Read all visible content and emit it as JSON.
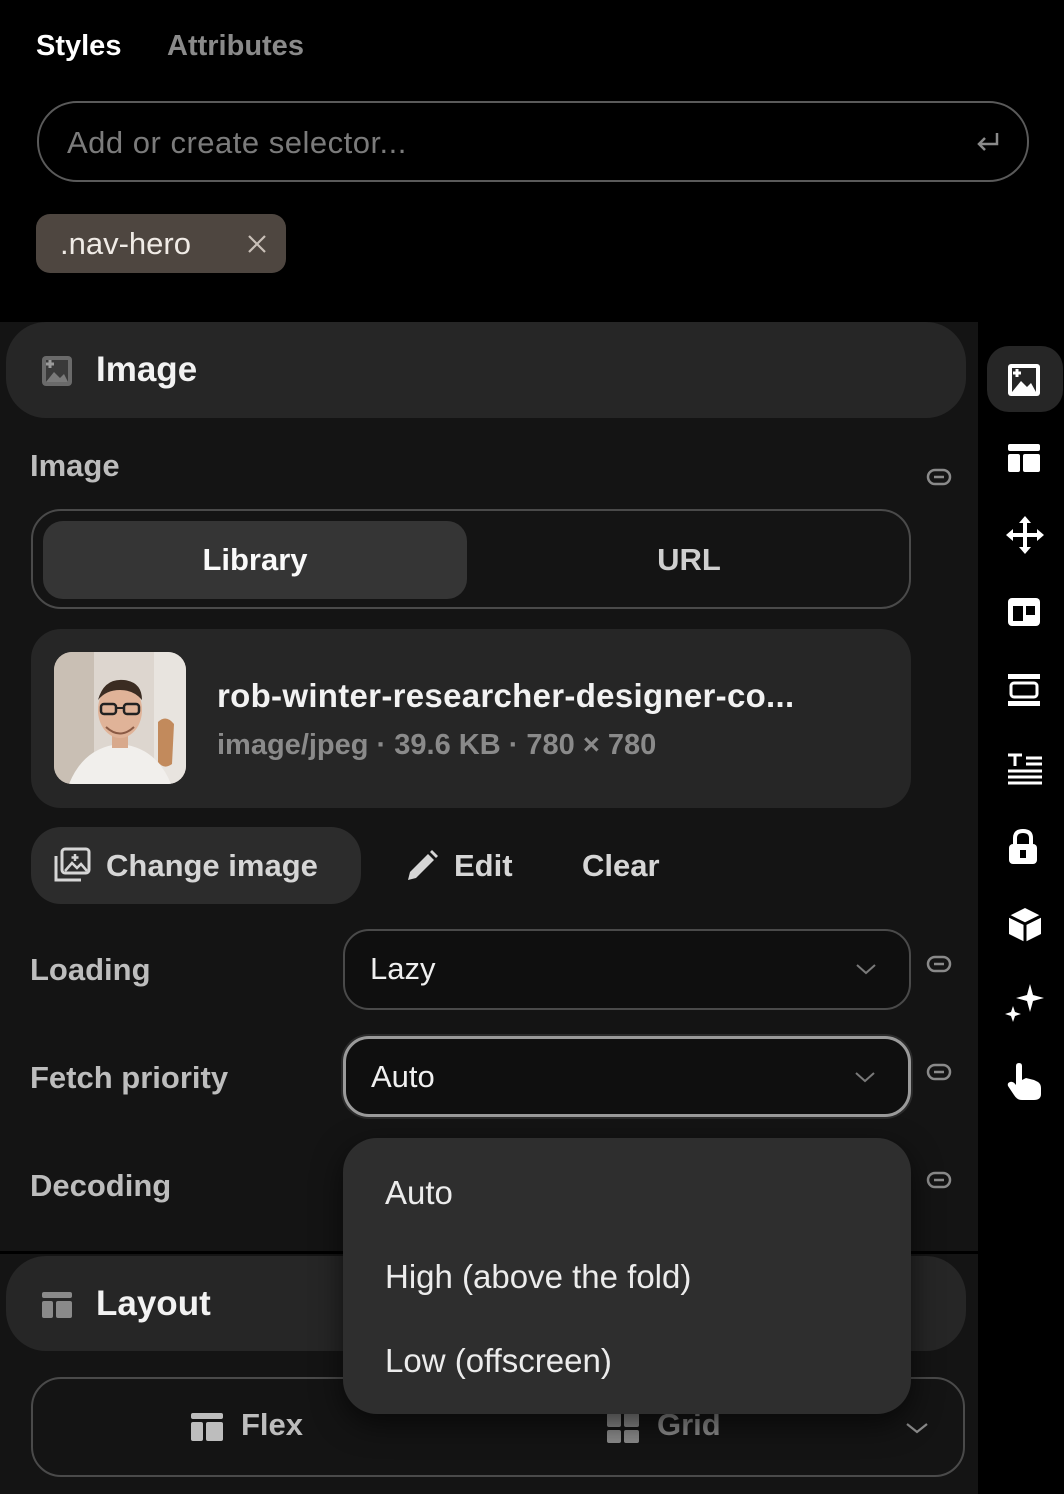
{
  "tabs": {
    "styles": "Styles",
    "attributes": "Attributes"
  },
  "selector": {
    "placeholder": "Add or create selector..."
  },
  "chip": {
    "label": ".nav-hero"
  },
  "image_section": {
    "title": "Image",
    "image_label": "Image",
    "segment": {
      "library": "Library",
      "url": "URL",
      "selected": "Library"
    },
    "file": {
      "name": "rob-winter-researcher-designer-co...",
      "meta": "image/jpeg · 39.6 KB · 780 × 780"
    },
    "actions": {
      "change": "Change image",
      "edit": "Edit",
      "clear": "Clear"
    },
    "loading": {
      "label": "Loading",
      "value": "Lazy"
    },
    "fetch_priority": {
      "label": "Fetch priority",
      "value": "Auto"
    },
    "decoding": {
      "label": "Decoding"
    },
    "dropdown_options": [
      "Auto",
      "High (above the fold)",
      "Low (offscreen)"
    ]
  },
  "layout_section": {
    "title": "Layout",
    "flex": "Flex",
    "grid": "Grid"
  },
  "rail_icons": [
    "image-icon",
    "layout-icon",
    "move-icon",
    "position-icon",
    "spacing-icon",
    "typography-icon",
    "lock-icon",
    "cube-icon",
    "sparkle-icon",
    "hand-pointer-icon"
  ],
  "colors": {
    "background": "#000000",
    "panel": "#141414",
    "card": "#262626",
    "chip": "#4e4640"
  }
}
